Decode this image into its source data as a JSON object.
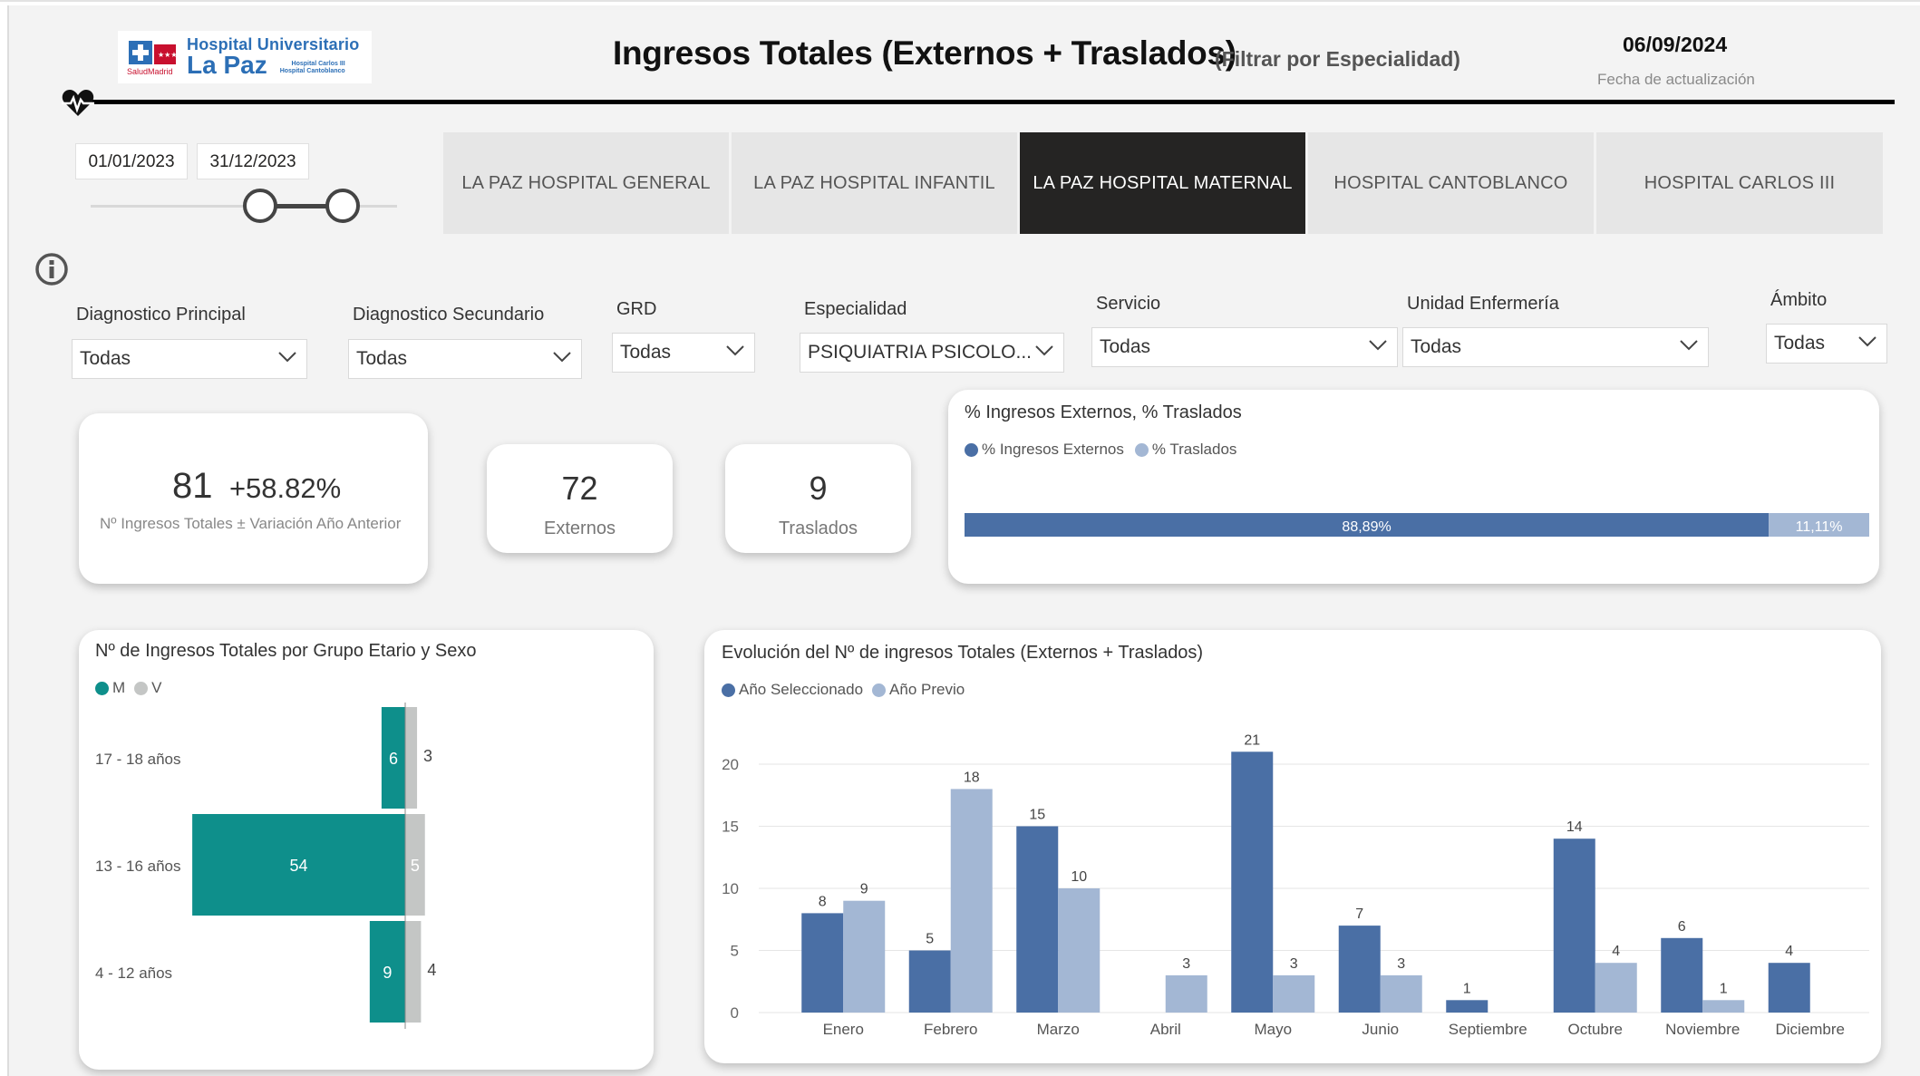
{
  "header": {
    "logo": {
      "line1": "Hospital Universitario",
      "line2": "La Paz",
      "sub1": "Hospital Carlos III",
      "sub2": "Hospital Cantoblanco",
      "salud": "SaludMadrid"
    },
    "title": "Ingresos Totales (Externos + Traslados)",
    "subtitle": "(Filtrar por Especialidad)",
    "update_date": "06/09/2024",
    "update_label": "Fecha de actualización"
  },
  "date_range": {
    "start": "01/01/2023",
    "end": "31/12/2023"
  },
  "tabs": [
    {
      "label": "LA PAZ HOSPITAL GENERAL",
      "active": false
    },
    {
      "label": "LA PAZ HOSPITAL INFANTIL",
      "active": false
    },
    {
      "label": "LA PAZ HOSPITAL MATERNAL",
      "active": true
    },
    {
      "label": "HOSPITAL CANTOBLANCO",
      "active": false
    },
    {
      "label": "HOSPITAL CARLOS III",
      "active": false
    }
  ],
  "filters": [
    {
      "label": "Diagnostico Principal",
      "value": "Todas"
    },
    {
      "label": "Diagnostico Secundario",
      "value": "Todas"
    },
    {
      "label": "GRD",
      "value": "Todas"
    },
    {
      "label": "Especialidad",
      "value": "PSIQUIATRIA PSICOLO..."
    },
    {
      "label": "Servicio",
      "value": "Todas"
    },
    {
      "label": "Unidad Enfermería",
      "value": "Todas"
    },
    {
      "label": "Ámbito",
      "value": "Todas"
    }
  ],
  "kpis": {
    "total": {
      "value": "81",
      "variation": "+58.82%",
      "caption": "Nº Ingresos Totales ± Variación Año Anterior"
    },
    "externos": {
      "value": "72",
      "label": "Externos"
    },
    "traslados": {
      "value": "9",
      "label": "Traslados"
    }
  },
  "colors": {
    "selected_year": "#4a6fa5",
    "previous_year": "#a3b7d4",
    "female": "#0e8f8b",
    "male": "#c4c6c5"
  },
  "chart_data": [
    {
      "type": "bar",
      "orientation": "horizontal-stacked",
      "title": "% Ingresos Externos, % Traslados",
      "legend": [
        "% Ingresos Externos",
        "% Traslados"
      ],
      "series": [
        {
          "name": "% Ingresos Externos",
          "value": 88.89,
          "label": "88,89%"
        },
        {
          "name": "% Traslados",
          "value": 11.11,
          "label": "11,11%"
        }
      ]
    },
    {
      "type": "bar",
      "orientation": "horizontal-butterfly",
      "title": "Nº de Ingresos Totales por Grupo Etario y Sexo",
      "legend": [
        "M",
        "V"
      ],
      "categories": [
        "17 - 18 años",
        "13 - 16 años",
        "4 - 12 años"
      ],
      "series": [
        {
          "name": "M",
          "values": [
            6,
            54,
            9
          ]
        },
        {
          "name": "V",
          "values": [
            3,
            5,
            4
          ]
        }
      ]
    },
    {
      "type": "bar",
      "title": "Evolución del Nº de ingresos Totales (Externos + Traslados)",
      "legend": [
        "Año Seleccionado",
        "Año Previo"
      ],
      "categories": [
        "Enero",
        "Febrero",
        "Marzo",
        "Abril",
        "Mayo",
        "Junio",
        "Septiembre",
        "Octubre",
        "Noviembre",
        "Diciembre"
      ],
      "series": [
        {
          "name": "Año Seleccionado",
          "values": [
            8,
            5,
            15,
            null,
            21,
            7,
            1,
            14,
            6,
            4
          ]
        },
        {
          "name": "Año Previo",
          "values": [
            9,
            18,
            10,
            3,
            3,
            3,
            null,
            4,
            1,
            null
          ]
        }
      ],
      "yticks": [
        "0",
        "5",
        "10",
        "15",
        "20"
      ],
      "ylim": [
        0,
        22
      ],
      "grid": true
    }
  ]
}
